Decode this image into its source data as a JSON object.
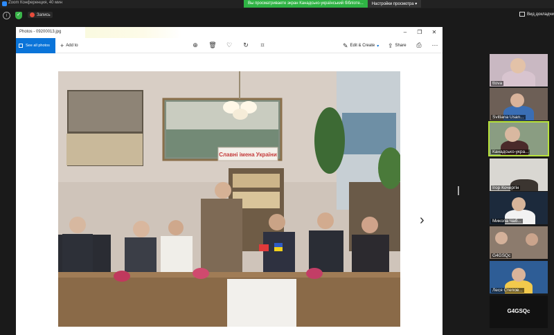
{
  "zoom": {
    "window_title": "Zoom Конференция, 40 мин",
    "share_banner": "Вы просматриваете экран Канадсько-український бібліоте...",
    "view_options": "Настройки просмотра",
    "record_label": "Запись",
    "view_mode_label": "Вид докладчи"
  },
  "photos": {
    "title": "Photos - 09200013.jpg",
    "see_all": "See all photos",
    "add_to": "Add to",
    "edit_create": "Edit & Create",
    "share": "Share",
    "photo_banner": "Славні імена України"
  },
  "participants": [
    {
      "name": "ttova"
    },
    {
      "name": "Svitlana Usan..."
    },
    {
      "name": "Канадсько-укра..."
    },
    {
      "name": "Ігор Кочергін"
    },
    {
      "name": "Микола Чаб..."
    },
    {
      "name": "G4GSQc"
    },
    {
      "name": "Леся Степов..."
    },
    {
      "name": "G4GSQc"
    }
  ],
  "colors": {
    "accent": "#0a74d9",
    "share_green": "#2fb344",
    "active_speaker": "#b8e33b"
  }
}
